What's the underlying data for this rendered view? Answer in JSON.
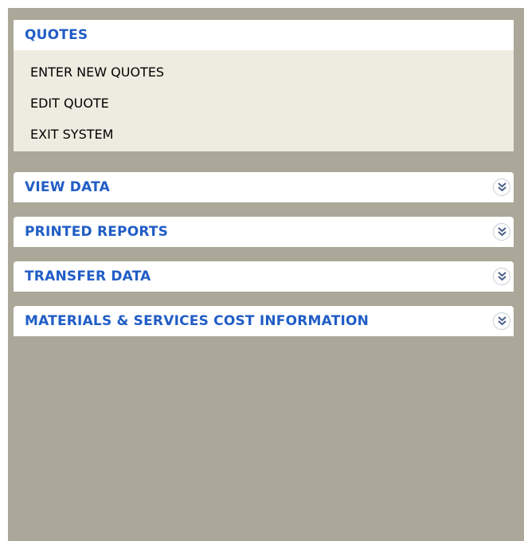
{
  "taskpane": {
    "open_group": {
      "title": "QUOTES",
      "items": [
        {
          "label": "ENTER NEW QUOTES"
        },
        {
          "label": "EDIT QUOTE"
        },
        {
          "label": "EXIT SYSTEM"
        }
      ]
    },
    "collapsed_groups": [
      {
        "title": "VIEW DATA",
        "icon": "chevron-double-down-icon"
      },
      {
        "title": "PRINTED REPORTS",
        "icon": "chevron-double-down-icon"
      },
      {
        "title": "TRANSFER DATA",
        "icon": "chevron-double-down-icon"
      },
      {
        "title": "MATERIALS & SERVICES COST INFORMATION",
        "icon": "chevron-double-down-icon"
      }
    ]
  },
  "colors": {
    "pane_background": "#aca899",
    "header_background": "#ffffff",
    "header_text": "#215dc6",
    "body_background": "#eeebe0"
  }
}
